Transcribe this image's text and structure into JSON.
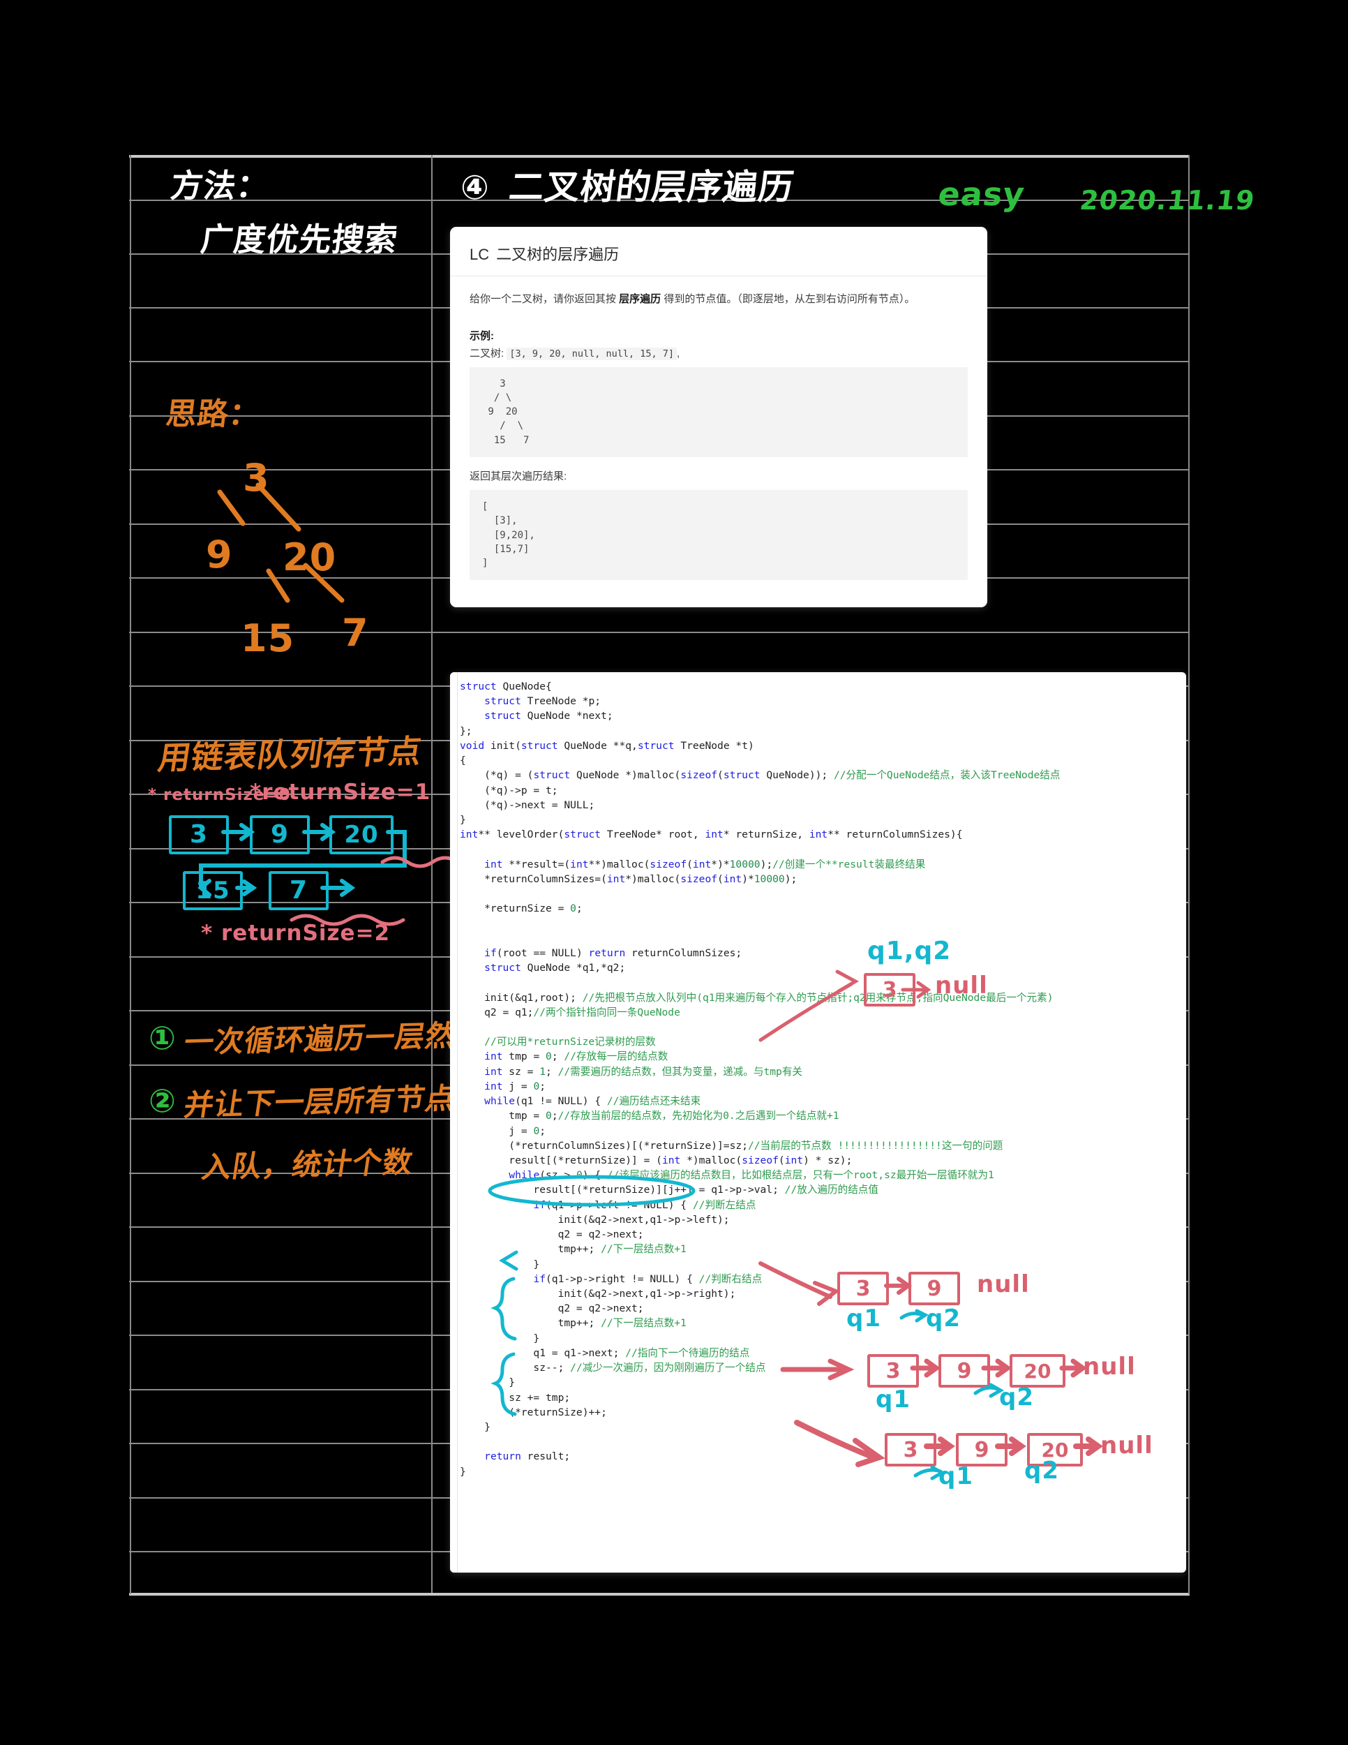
{
  "notebook": {
    "left_column": {
      "method_label": "方法：",
      "method_value": "广度优先搜索",
      "idea_label": "思路：",
      "tree": {
        "root": "3",
        "left": "9",
        "right": "20",
        "right_left": "15",
        "right_right": "7"
      },
      "queue_note": "用链表队列存节点",
      "queue_nodes_row1": [
        "3",
        "9",
        "20"
      ],
      "queue_nodes_row2": [
        "15",
        "7"
      ],
      "returnsize_0": "* returnSize=0",
      "returnsize_1": "*returnSize=1",
      "returnsize_2": "* returnSize=2",
      "steps": [
        {
          "marker": "①",
          "text": "一次循环遍历一层然"
        },
        {
          "marker": "②",
          "text": "并让下一层所有节点"
        },
        {
          "marker": "",
          "text": "入队，统计个数"
        }
      ]
    },
    "header": {
      "number": "④",
      "title": "二叉树的层序遍历",
      "difficulty": "easy",
      "date": "2020.11.19"
    }
  },
  "problem_card": {
    "source": "LC",
    "title": "二叉树的层序遍历",
    "description_pre": "给你一个二叉树，请你返回其按 ",
    "description_bold": "层序遍历",
    "description_post": " 得到的节点值。（即逐层地，从左到右访问所有节点）。",
    "example_label": "示例:",
    "tree_label": "二叉树:",
    "tree_array": "[3, 9, 20, null, null, 15, 7]",
    "tree_array_suffix": ",",
    "tree_ascii": "   3\n  / \\\n 9  20\n   /  \\\n  15   7",
    "return_label": "返回其层次遍历结果:",
    "result_ascii": "[\n  [3],\n  [9,20],\n  [15,7]\n]"
  },
  "code": {
    "lines": [
      "struct QueNode{",
      "    struct TreeNode *p;",
      "    struct QueNode *next;",
      "};",
      "void init(struct QueNode **q,struct TreeNode *t)",
      "{",
      "    (*q) = (struct QueNode *)malloc(sizeof(struct QueNode)); //分配一个QueNode结点，装入该TreeNode结点",
      "    (*q)->p = t;",
      "    (*q)->next = NULL;",
      "}",
      "int** levelOrder(struct TreeNode* root, int* returnSize, int** returnColumnSizes){",
      "",
      "    int **result=(int**)malloc(sizeof(int*)*10000);//创建一个**result装最终结果",
      "    *returnColumnSizes=(int*)malloc(sizeof(int)*10000);",
      "",
      "    *returnSize = 0;",
      "",
      "",
      "    if(root == NULL) return returnColumnSizes;",
      "    struct QueNode *q1,*q2;",
      "",
      "    init(&q1,root); //先把根节点放入队列中(q1用来遍历每个存入的节点指针;q2用来存节点,指向QueNode最后一个元素)",
      "    q2 = q1;//两个指针指向同一条QueNode",
      "",
      "    //可以用*returnSize记录树的层数",
      "    int tmp = 0; //存放每一层的结点数",
      "    int sz = 1; //需要遍历的结点数，但其为变量，递减。与tmp有关",
      "    int j = 0;",
      "    while(q1 != NULL) { //遍历结点还未结束",
      "        tmp = 0;//存放当前层的结点数，先初始化为0.之后遇到一个结点就+1",
      "        j = 0;",
      "        (*returnColumnSizes)[(*returnSize)]=sz;//当前层的节点数 !!!!!!!!!!!!!!!!!这一句的问题",
      "        result[(*returnSize)] = (int *)malloc(sizeof(int) * sz);",
      "        while(sz > 0) { //该层应该遍历的结点数目，比如根结点层，只有一个root,sz最开始一层循环就为1",
      "            result[(*returnSize)][j++] = q1->p->val; //放入遍历的结点值",
      "            if(q1->p->left != NULL) { //判断左结点",
      "                init(&q2->next,q1->p->left);",
      "                q2 = q2->next;",
      "                tmp++; //下一层结点数+1",
      "            }",
      "            if(q1->p->right != NULL) { //判断右结点",
      "                init(&q2->next,q1->p->right);",
      "                q2 = q2->next;",
      "                tmp++; //下一层结点数+1",
      "            }",
      "            q1 = q1->next; //指向下一个待遍历的结点",
      "            sz--; //减少一次遍历，因为刚刚遍历了一个结点",
      "        }",
      "        sz += tmp;",
      "        (*returnSize)++;",
      "    }",
      "",
      "    return result;",
      "}"
    ]
  },
  "annotations": {
    "diagram1": {
      "labels": "q1,q2",
      "nodes": [
        "3"
      ],
      "tail": "null"
    },
    "diagram2": {
      "nodes": [
        "3",
        "9"
      ],
      "tail": "null",
      "label_q1": "q1",
      "label_q2": "q2"
    },
    "diagram3": {
      "nodes": [
        "3",
        "9",
        "20"
      ],
      "tail": "null",
      "label_q1": "q1",
      "label_q2": "q2"
    },
    "diagram4": {
      "nodes": [
        "3",
        "9",
        "20"
      ],
      "tail": "null",
      "label_q1": "q1",
      "label_q2": "q2"
    }
  },
  "colors": {
    "orange": "#e07b22",
    "green": "#2fbf3f",
    "cyan": "#13b7cf",
    "pink": "#e4707e",
    "white": "#ffffff",
    "code_keyword": "#2020e0",
    "code_comment": "#2e9b4e",
    "code_number": "#1f8a4c"
  }
}
